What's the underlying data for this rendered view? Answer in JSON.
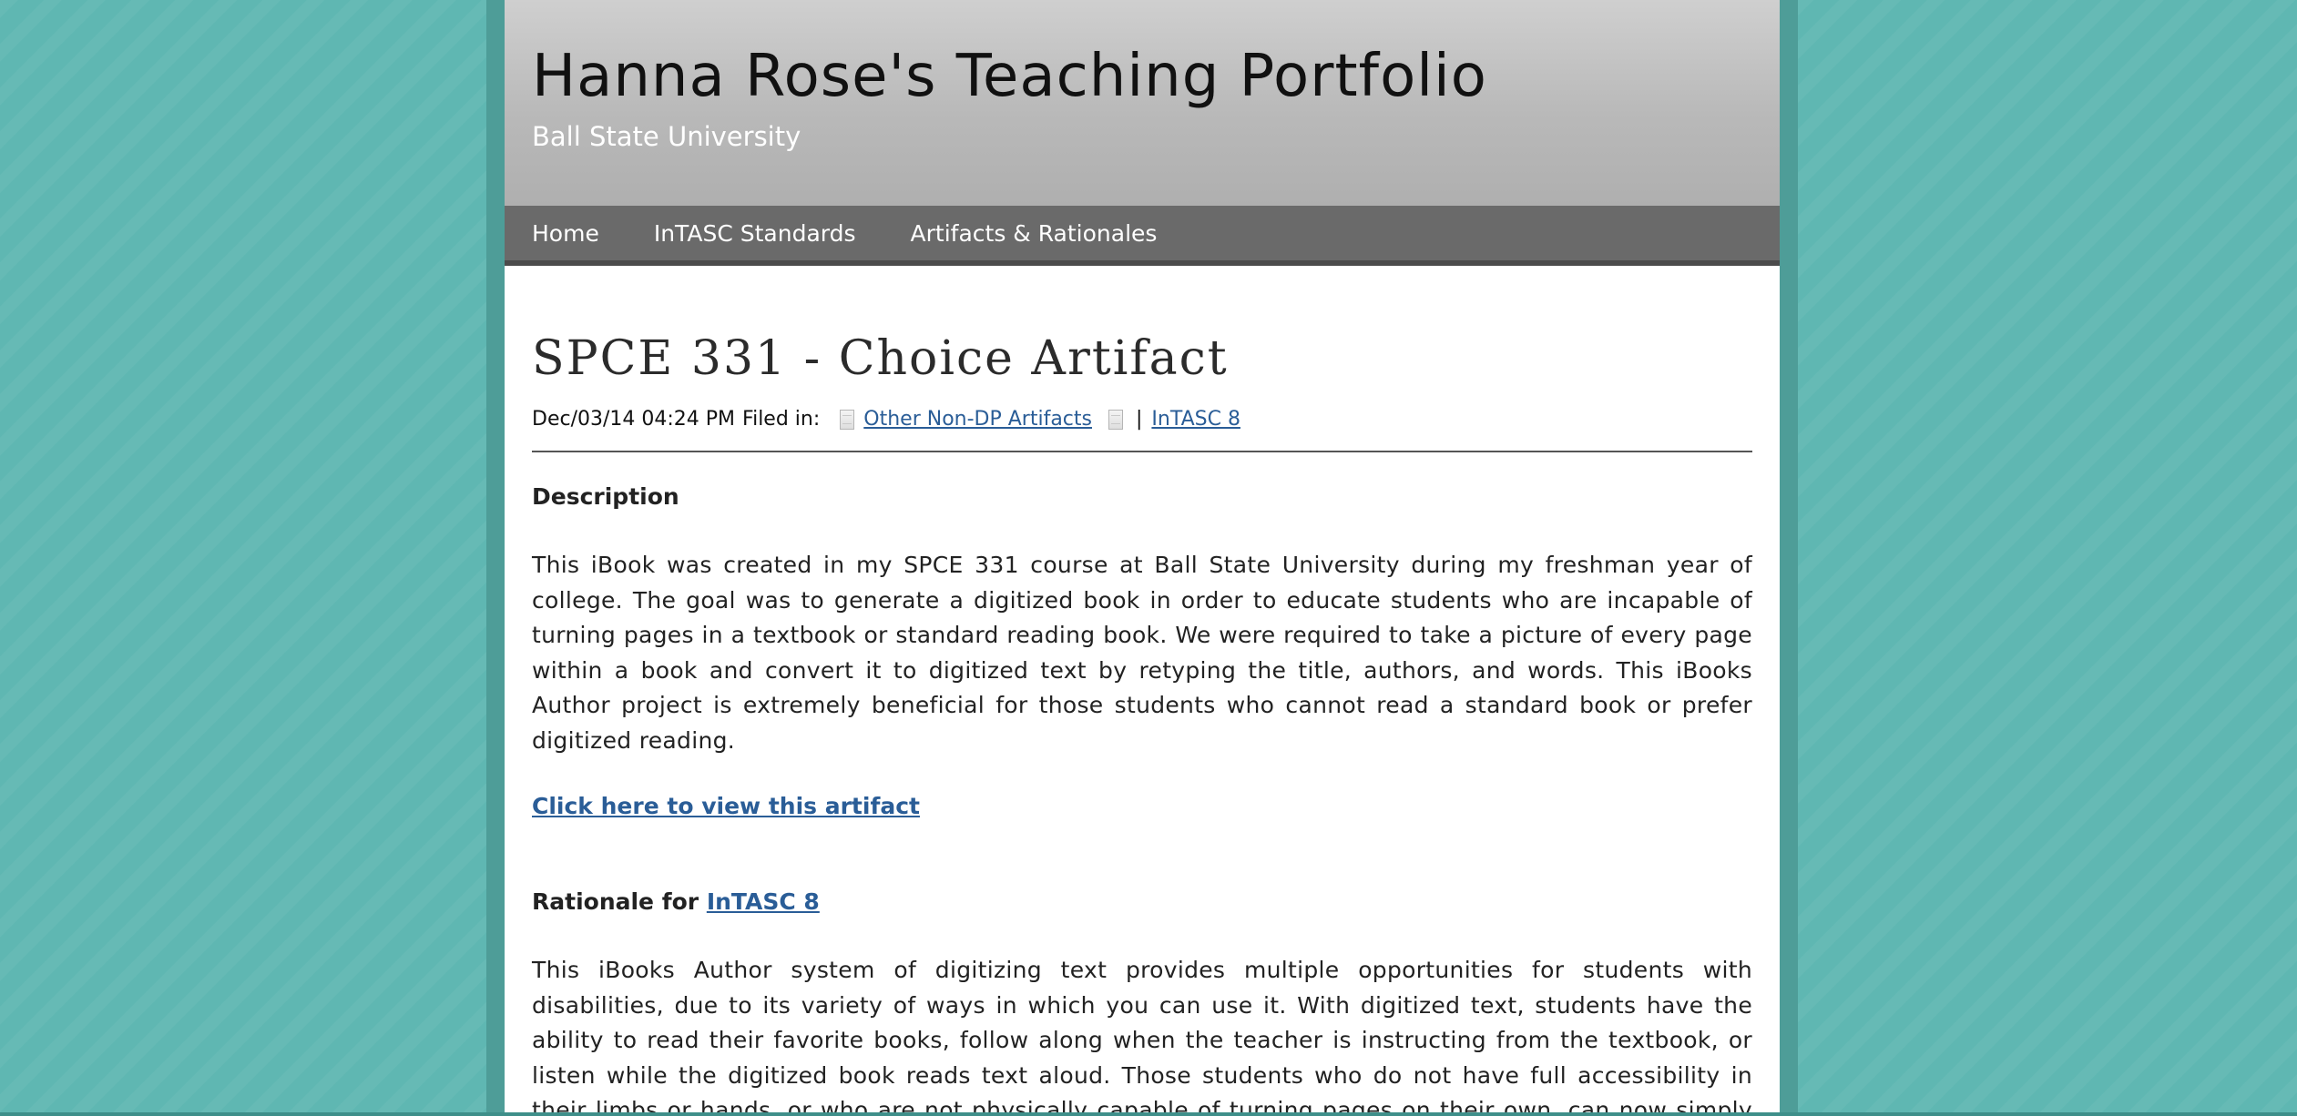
{
  "site": {
    "title": "Hanna Rose's Teaching Portfolio",
    "subtitle": "Ball State University"
  },
  "nav": {
    "items": [
      {
        "label": "Home"
      },
      {
        "label": "InTASC Standards"
      },
      {
        "label": "Artifacts & Rationales"
      }
    ]
  },
  "post": {
    "title": "SPCE 331 - Choice Artifact",
    "timestamp": "Dec/03/14 04:24 PM",
    "filed_in_label": "Filed in:",
    "categories": [
      {
        "label": "Other Non-DP Artifacts",
        "icon": "document-icon"
      },
      {
        "label": "InTASC 8",
        "icon": "document-icon"
      }
    ],
    "separator": "|",
    "description_heading": "Description",
    "description_text": "This iBook was created in my SPCE 331 course at Ball State University during my freshman year of college. The goal was to generate a digitized book in order to educate students who are incapable of turning pages in a textbook or standard reading book. We were required to take a picture of every page within a book and convert it to digitized text by retyping the title, authors, and words. This iBooks Author project is extremely beneficial for those students who cannot read a standard book or prefer digitized reading.",
    "artifact_link": "Click here to view this artifact",
    "rationale_prefix": "Rationale for",
    "rationale_link": "InTASC 8",
    "rationale_text": "This iBooks Author system of digitizing text provides multiple opportunities for students with disabilities, due to its variety of ways in which you can use it. With digitized text, students have the ability to read their favorite books, follow along when the teacher is instructing from the textbook, or listen while the digitized book reads text aloud. Those students who do not have full accessibility in their limbs or hands, or who are not physically capable of turning pages on their own, can now simply swipe a touch screen in order to advance to the next page."
  },
  "colors": {
    "background": "#5fb7b2",
    "header": "#b9b9b9",
    "navbar": "#6a6a6a",
    "link": "#2a5d97"
  }
}
